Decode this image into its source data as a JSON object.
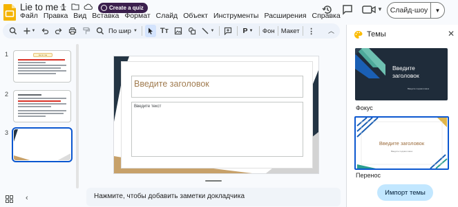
{
  "app": {
    "doc_title": "Lie to me 1",
    "quiz_chip_label": "Create a quiz",
    "menu": [
      "Файл",
      "Правка",
      "Вид",
      "Вставка",
      "Формат",
      "Слайд",
      "Объект",
      "Инструменты",
      "Расширения",
      "Справка"
    ],
    "slideshow_label": "Слайд-шоу"
  },
  "toolbar": {
    "zoom_label": "По шир",
    "background_label": "Фон",
    "layout_label": "Макет"
  },
  "filmstrip": {
    "slides": [
      {
        "number": "1",
        "title_text": "Lie to me"
      },
      {
        "number": "2"
      },
      {
        "number": "3"
      }
    ],
    "selected_index": 3
  },
  "canvas": {
    "title_placeholder": "Введите заголовок",
    "body_placeholder": "Введите текст"
  },
  "notes": {
    "placeholder": "Нажмите, чтобы добавить заметки докладчика"
  },
  "themes_panel": {
    "title": "Темы",
    "themes": [
      {
        "name": "Фокус",
        "preview_title": "Введите заголовок",
        "preview_subtitle": "Введите подзаголовок"
      },
      {
        "name": "Перенос",
        "preview_title": "Введите заголовок",
        "preview_subtitle": "Введите подзаголовок"
      }
    ],
    "import_label": "Импорт темы"
  },
  "colors": {
    "accent_blue": "#0b57d0",
    "slide_gold": "#c7a16a",
    "slide_dark": "#233443",
    "import_button": "#c2e7ff"
  }
}
